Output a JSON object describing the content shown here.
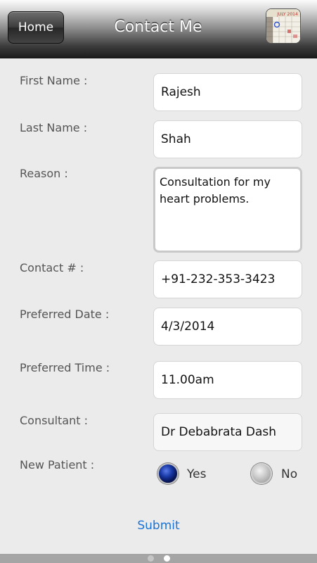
{
  "navbar": {
    "home_label": "Home",
    "title": "Contact Me",
    "calendar_header": "JULY 2014"
  },
  "form": {
    "first_name": {
      "label": "First Name :",
      "value": "Rajesh"
    },
    "last_name": {
      "label": "Last Name :",
      "value": "Shah"
    },
    "reason": {
      "label": "Reason :",
      "value": "Consultation for my heart problems."
    },
    "contact": {
      "label": "Contact # :",
      "value": "+91-232-353-3423"
    },
    "preferred_date": {
      "label": "Preferred Date :",
      "value": "4/3/2014"
    },
    "preferred_time": {
      "label": "Preferred Time :",
      "value": "11.00am"
    },
    "consultant": {
      "label": "Consultant :",
      "value": "Dr Debabrata Dash"
    },
    "new_patient": {
      "label": "New Patient :",
      "options": [
        {
          "label": "Yes",
          "selected": true
        },
        {
          "label": "No",
          "selected": false
        }
      ]
    }
  },
  "submit_label": "Submit",
  "pager": {
    "count": 2,
    "active_index": 1
  },
  "colors": {
    "link": "#1a73d9",
    "radio_selected": "#1a3aa8"
  }
}
